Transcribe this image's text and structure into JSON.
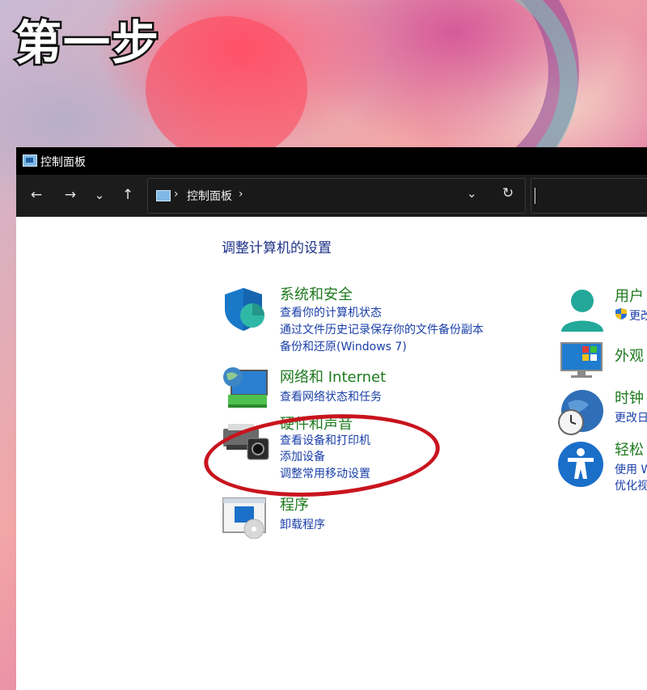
{
  "overlay": {
    "step_text": "第一步"
  },
  "window": {
    "title": "控制面板",
    "nav": {
      "back": "←",
      "forward": "→",
      "recent": "⌄",
      "up": "↑"
    },
    "address": {
      "crumb": "控制面板",
      "separator": "›",
      "dropdown": "⌄",
      "refresh": "↻"
    }
  },
  "content": {
    "heading": "调整计算机的设置",
    "left_categories": [
      {
        "title": "系统和安全",
        "links": [
          "查看你的计算机状态",
          "通过文件历史记录保存你的文件备份副本",
          "备份和还原(Windows 7)"
        ],
        "icon": "shield-icon"
      },
      {
        "title": "网络和 Internet",
        "links": [
          "查看网络状态和任务"
        ],
        "icon": "network-globe-icon"
      },
      {
        "title": "硬件和声音",
        "links": [
          "查看设备和打印机",
          "添加设备",
          "调整常用移动设置"
        ],
        "icon": "printer-icon"
      },
      {
        "title": "程序",
        "links": [
          "卸载程序"
        ],
        "icon": "programs-icon"
      }
    ],
    "right_categories": [
      {
        "title": "用户",
        "links": [
          "更改"
        ],
        "icon": "user-icon"
      },
      {
        "title": "外观",
        "links": [],
        "icon": "appearance-monitor-icon"
      },
      {
        "title": "时钟",
        "links": [
          "更改日"
        ],
        "icon": "clock-globe-icon"
      },
      {
        "title": "轻松",
        "links": [
          "使用 W",
          "优化视"
        ],
        "icon": "accessibility-icon"
      }
    ]
  },
  "colors": {
    "category_title": "#1e7a1e",
    "link": "#1a3fa8",
    "heading": "#1e3287",
    "annotation_circle": "#c8141e"
  }
}
